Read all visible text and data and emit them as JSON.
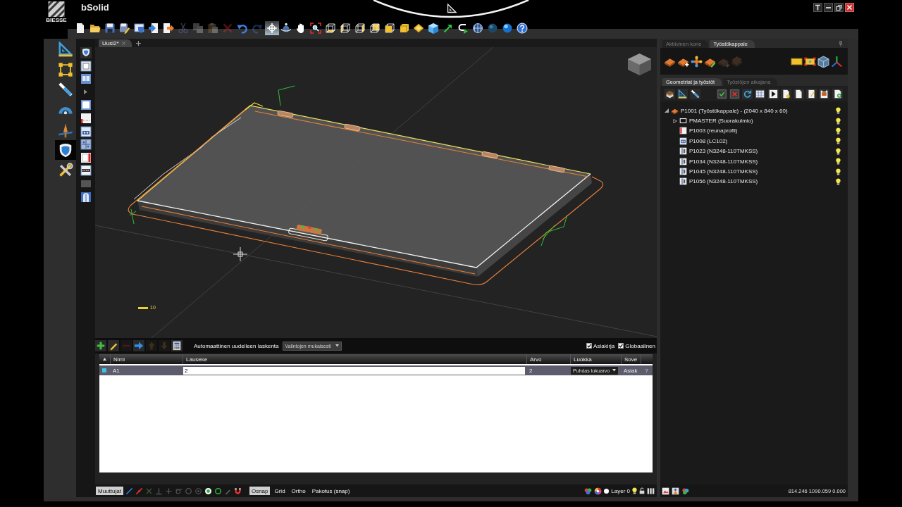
{
  "window": {
    "logo": "BIESSE",
    "title": "bSolid"
  },
  "toolbar": [
    {
      "kind": "new",
      "disabled": false,
      "active": false
    },
    {
      "kind": "open",
      "disabled": false,
      "active": false
    },
    {
      "kind": "save",
      "disabled": false,
      "active": false
    },
    {
      "kind": "save_as",
      "disabled": false,
      "active": false
    },
    {
      "kind": "shield_window",
      "disabled": false,
      "active": false
    },
    {
      "kind": "import",
      "disabled": false,
      "active": false
    },
    {
      "kind": "export",
      "disabled": false,
      "active": false
    },
    {
      "kind": "cut",
      "disabled": true,
      "active": false
    },
    {
      "kind": "copy",
      "disabled": true,
      "active": false
    },
    {
      "kind": "paste",
      "disabled": true,
      "active": false
    },
    {
      "kind": "delete",
      "disabled": true,
      "active": false
    },
    {
      "kind": "undo",
      "disabled": false,
      "active": false
    },
    {
      "kind": "redo",
      "disabled": true,
      "active": false
    },
    {
      "kind": "crosshair",
      "disabled": false,
      "active": true
    },
    {
      "kind": "orbit",
      "disabled": false,
      "active": false
    },
    {
      "kind": "pan",
      "disabled": false,
      "active": false
    },
    {
      "kind": "zoom",
      "disabled": false,
      "active": false
    },
    {
      "kind": "cube_bottom",
      "disabled": false,
      "active": false
    },
    {
      "kind": "cube_left",
      "disabled": false,
      "active": false
    },
    {
      "kind": "cube_right",
      "disabled": false,
      "active": false
    },
    {
      "kind": "cube_back",
      "disabled": false,
      "active": false
    },
    {
      "kind": "cube_front",
      "disabled": false,
      "active": false
    },
    {
      "kind": "cube_solid",
      "disabled": false,
      "active": false
    },
    {
      "kind": "top_view",
      "disabled": false,
      "active": false
    },
    {
      "kind": "shaded_cube",
      "disabled": false,
      "active": false
    },
    {
      "kind": "pointer",
      "disabled": false,
      "active": false
    },
    {
      "kind": "curve",
      "disabled": false,
      "active": false
    },
    {
      "kind": "grid_globe",
      "disabled": false,
      "active": false
    },
    {
      "kind": "sphere",
      "disabled": false,
      "active": false
    },
    {
      "kind": "shaded_sphere",
      "disabled": false,
      "active": false
    },
    {
      "kind": "help",
      "disabled": false,
      "active": false
    }
  ],
  "left_tools": [
    {
      "kind": "set_square",
      "selected": false
    },
    {
      "kind": "bounding_box",
      "selected": false
    },
    {
      "kind": "line",
      "selected": false
    },
    {
      "kind": "protractor",
      "selected": false
    },
    {
      "kind": "axis_pin",
      "selected": false
    },
    {
      "kind": "shield",
      "selected": true
    },
    {
      "kind": "tools",
      "selected": false
    }
  ],
  "document_tabs": [
    {
      "label": "Uusi2*",
      "selected": true
    }
  ],
  "viewport": {
    "scale_label": "10"
  },
  "variables": {
    "tools": [
      {
        "kind": "add",
        "disabled": false
      },
      {
        "kind": "edit",
        "disabled": false
      },
      {
        "kind": "remove",
        "disabled": true
      },
      {
        "kind": "arrow_right",
        "disabled": false
      },
      {
        "kind": "up",
        "disabled": true
      },
      {
        "kind": "down",
        "disabled": true
      },
      {
        "kind": "calculator",
        "disabled": false
      }
    ],
    "recalc_label": "Automaattinen uudelleen laskenta",
    "recalc_mode": "Valintojen mukaisesti",
    "options": [
      {
        "label": "Asiakirja",
        "checked": true
      },
      {
        "label": "Globaalinen",
        "checked": true
      }
    ],
    "columns": [
      "Nimi",
      "Lauseke",
      "Arvo",
      "Luokka",
      "Sove"
    ],
    "rows": [
      {
        "name": "A1",
        "expression": "2",
        "value": "2",
        "class": "Puhdas lukuarvo",
        "scope": "Asiak",
        "help": "?",
        "selected": true
      }
    ]
  },
  "status_bar": {
    "panel_toggle": {
      "label": "Muuttujat",
      "on": true
    },
    "snaps": [
      {
        "kind": "line",
        "on": true
      },
      {
        "kind": "midpoint",
        "on": true
      },
      {
        "kind": "intersection",
        "on": false
      },
      {
        "kind": "perpendicular",
        "on": false
      },
      {
        "kind": "cross",
        "on": false
      },
      {
        "kind": "tangent",
        "on": false
      },
      {
        "kind": "circle",
        "on": false
      },
      {
        "kind": "quadrant",
        "on": false
      },
      {
        "kind": "center",
        "on": true
      },
      {
        "kind": "ring",
        "on": true
      },
      {
        "kind": "nearest",
        "on": false
      },
      {
        "kind": "magnet",
        "on": true
      }
    ],
    "toggles": [
      {
        "label": "Osnap",
        "on": true
      },
      {
        "label": "Grid",
        "on": false
      },
      {
        "label": "Ortho",
        "on": false
      },
      {
        "label": "Pakotus (snap)",
        "on": false
      }
    ],
    "layer": {
      "name": "Layer 0",
      "color": "#ffffff",
      "visible": true,
      "locked": false
    },
    "coordinates": "814.246 1090.059 0.000"
  },
  "right_panel": {
    "tabs": [
      {
        "label": "Aktiivinen kone",
        "selected": false
      },
      {
        "label": "Työstökappale",
        "selected": true
      }
    ],
    "tools_left": [
      {
        "kind": "slab",
        "disabled": false
      },
      {
        "kind": "add_slab",
        "disabled": false
      },
      {
        "kind": "node_cross",
        "disabled": false
      },
      {
        "kind": "edit_slab",
        "disabled": false
      },
      {
        "kind": "slab_arrow",
        "disabled": true
      },
      {
        "kind": "slab_stack",
        "disabled": true
      }
    ],
    "tools_right": [
      {
        "kind": "rect_fill",
        "disabled": false
      },
      {
        "kind": "bound_rect",
        "disabled": false
      },
      {
        "kind": "wire_cube",
        "disabled": false
      },
      {
        "kind": "axes",
        "disabled": false
      }
    ],
    "subtabs": [
      {
        "label": "Geometriat ja työstöt",
        "selected": true
      },
      {
        "label": "Työstöjen aikajana",
        "selected": false
      }
    ],
    "tree": [
      {
        "label": "P1001 (Työstökappale) - (2040 x 840 x 60)",
        "kind": "piece",
        "expanded": true,
        "visible": true,
        "children": [
          {
            "label": "PMASTER (Suorakulmio)",
            "kind": "rectangle",
            "expanded": false,
            "visible": true
          },
          {
            "label": "P1003 (reunaprofil)",
            "kind": "profile",
            "visible": true
          },
          {
            "label": "P1008 (LC102)",
            "kind": "drilling",
            "visible": true
          },
          {
            "label": "P1023 (N3248-110TMKSS)",
            "kind": "hinge",
            "visible": true
          },
          {
            "label": "P1034 (N3248-110TMKSS)",
            "kind": "hinge",
            "visible": true
          },
          {
            "label": "P1045 (N3248-110TMKSS)",
            "kind": "hinge",
            "visible": true
          },
          {
            "label": "P1056 (N3248-110TMKSS)",
            "kind": "hinge",
            "visible": true
          }
        ]
      }
    ]
  }
}
